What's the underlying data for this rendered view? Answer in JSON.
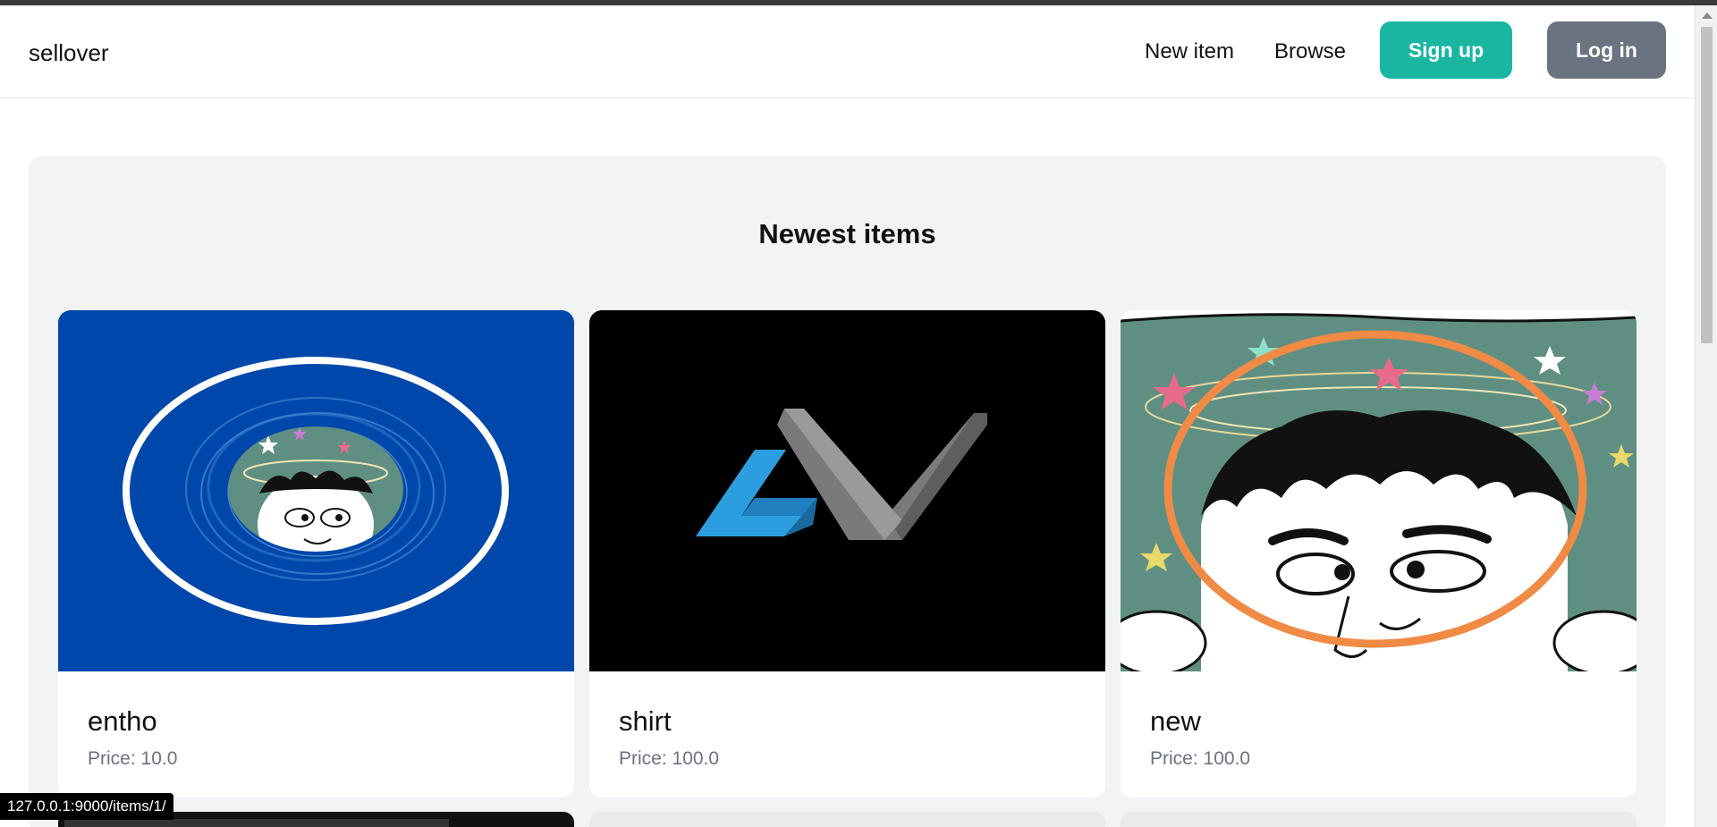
{
  "navbar": {
    "brand": "sellover",
    "links": {
      "new_item": "New item",
      "browse": "Browse"
    },
    "buttons": {
      "signup": "Sign up",
      "login": "Log in"
    },
    "colors": {
      "signup": "#1ab6a2",
      "login": "#6b7280"
    }
  },
  "section": {
    "title": "Newest items",
    "items": [
      {
        "name": "entho",
        "price": "Price: 10.0",
        "image": "dizzy-cartoon-face-in-white-ring-on-blue"
      },
      {
        "name": "shirt",
        "price": "Price: 100.0",
        "image": "blue-grey-angular-logo-on-black"
      },
      {
        "name": "new",
        "price": "Price: 100.0",
        "image": "dizzy-cartoon-face-with-orange-ring"
      }
    ]
  },
  "status_bar": {
    "url": "127.0.0.1:9000/items/1/"
  }
}
